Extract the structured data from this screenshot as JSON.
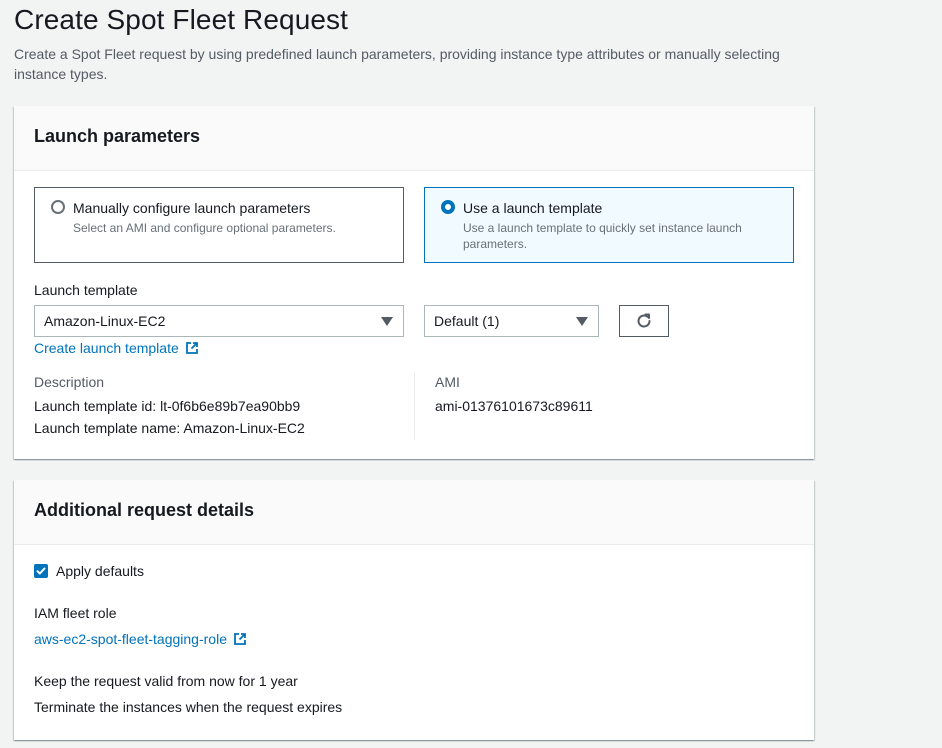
{
  "page": {
    "title": "Create Spot Fleet Request",
    "description": "Create a Spot Fleet request by using predefined launch parameters, providing instance type attributes or manually selecting instance types."
  },
  "launch_parameters": {
    "title": "Launch parameters",
    "options": [
      {
        "label": "Manually configure launch parameters",
        "description": "Select an AMI and configure optional parameters.",
        "selected": false
      },
      {
        "label": "Use a launch template",
        "description": "Use a launch template to quickly set instance launch parameters.",
        "selected": true
      }
    ],
    "template_label": "Launch template",
    "template_value": "Amazon-Linux-EC2",
    "version_value": "Default (1)",
    "create_link": "Create launch template",
    "description_label": "Description",
    "template_id": "Launch template id: lt-0f6b6e89b7ea90bb9",
    "template_name": "Launch template name: Amazon-Linux-EC2",
    "ami_label": "AMI",
    "ami_value": "ami-01376101673c89611"
  },
  "additional": {
    "title": "Additional request details",
    "apply_defaults_label": "Apply defaults",
    "apply_defaults_checked": true,
    "iam_label": "IAM fleet role",
    "iam_value": "aws-ec2-spot-fleet-tagging-role",
    "valid_text": "Keep the request valid from now for 1 year",
    "terminate_text": "Terminate the instances when the request expires"
  },
  "colors": {
    "accent": "#0073bb",
    "background": "#f2f3f3"
  },
  "icons": {
    "external_link": "external-link-icon",
    "refresh": "refresh-icon",
    "caret": "caret-down-icon"
  }
}
